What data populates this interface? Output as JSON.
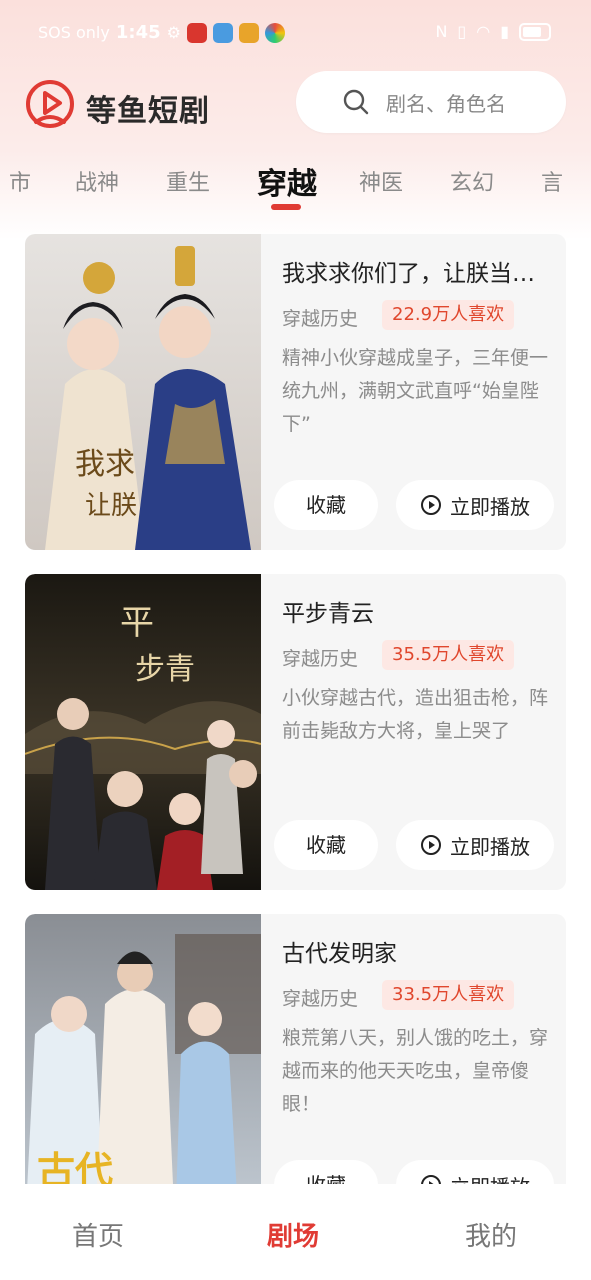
{
  "status_bar": {
    "carrier": "SOS only",
    "time": "1:45"
  },
  "header": {
    "app_name": "等鱼短剧",
    "search": {
      "placeholder": "剧名、角色名"
    }
  },
  "tabs": [
    {
      "label": "市",
      "active": false
    },
    {
      "label": "战神",
      "active": false
    },
    {
      "label": "重生",
      "active": false
    },
    {
      "label": "穿越",
      "active": true
    },
    {
      "label": "神医",
      "active": false
    },
    {
      "label": "玄幻",
      "active": false
    },
    {
      "label": "言",
      "active": false
    }
  ],
  "cards": [
    {
      "title": "我求求你们了，让朕当…",
      "genre": "穿越历史",
      "likes": "22.9万人喜欢",
      "description": "精神小伙穿越成皇子，三年便一统九州，满朝文武直呼“始皇陛下”",
      "fav_label": "收藏",
      "play_label": "立即播放"
    },
    {
      "title": "平步青云",
      "genre": "穿越历史",
      "likes": "35.5万人喜欢",
      "description": "小伙穿越古代，造出狙击枪，阵前击毙敌方大将，皇上哭了",
      "fav_label": "收藏",
      "play_label": "立即播放"
    },
    {
      "title": "古代发明家",
      "genre": "穿越历史",
      "likes": "33.5万人喜欢",
      "description": "粮荒第八天，别人饿的吃土，穿越而来的他天天吃虫，皇帝傻眼！",
      "fav_label": "收藏",
      "play_label": "立即播放"
    }
  ],
  "bottom_nav": [
    {
      "label": "首页",
      "active": false
    },
    {
      "label": "剧场",
      "active": true
    },
    {
      "label": "我的",
      "active": false
    }
  ],
  "colors": {
    "accent": "#e03b34",
    "likes_text": "#e0472d",
    "likes_bg": "#fde8e4"
  }
}
